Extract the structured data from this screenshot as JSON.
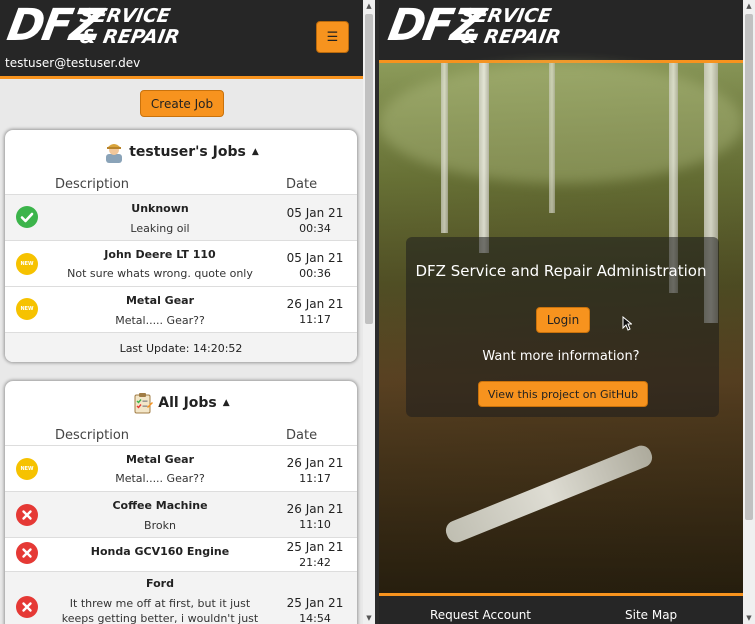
{
  "brand": {
    "dfz": "DFZ",
    "line1": "SERVICE",
    "line2": "& REPAIR"
  },
  "left": {
    "menu_icon": "☰",
    "user_email": "testuser@testuser.dev",
    "create_label": "Create Job",
    "my_jobs": {
      "title": "testuser's Jobs",
      "caret": "▲",
      "col_desc": "Description",
      "col_date": "Date",
      "rows": [
        {
          "status": "done",
          "title": "Unknown",
          "desc": "Leaking oil",
          "date": "05 Jan 21",
          "time": "00:34"
        },
        {
          "status": "new",
          "title": "John Deere LT 110",
          "desc": "Not sure whats wrong. quote only",
          "date": "05 Jan 21",
          "time": "00:36"
        },
        {
          "status": "new",
          "title": "Metal Gear",
          "desc": "Metal..... Gear??",
          "date": "26 Jan 21",
          "time": "11:17"
        }
      ],
      "last_update": "Last Update: 14:20:52"
    },
    "all_jobs": {
      "title": "All Jobs",
      "caret": "▲",
      "col_desc": "Description",
      "col_date": "Date",
      "rows": [
        {
          "status": "new",
          "title": "Metal Gear",
          "desc": "Metal..... Gear??",
          "date": "26 Jan 21",
          "time": "11:17"
        },
        {
          "status": "cancel",
          "title": "Coffee Machine",
          "desc": "Brokn",
          "date": "26 Jan 21",
          "time": "11:10"
        },
        {
          "status": "cancel",
          "title": "Honda GCV160 Engine",
          "desc": "",
          "date": "25 Jan 21",
          "time": "21:42"
        },
        {
          "status": "cancel",
          "title": "Ford",
          "desc_line1": "It threw me off at first, but it just",
          "desc_line2": "keeps getting better, i wouldn't just",
          "date": "25 Jan 21",
          "time": "14:54"
        }
      ]
    },
    "new_badge": "NEW"
  },
  "right": {
    "heading": "DFZ Service and Repair Administration",
    "login_label": "Login",
    "more_info": "Want more information?",
    "github_label": "View this project on GitHub",
    "footer": {
      "request": "Request Account",
      "sitemap": "Site Map"
    }
  },
  "colors": {
    "accent": "#f7931e",
    "header": "#262626",
    "done": "#3cb44b",
    "new": "#f6c200",
    "cancel": "#e53935"
  }
}
